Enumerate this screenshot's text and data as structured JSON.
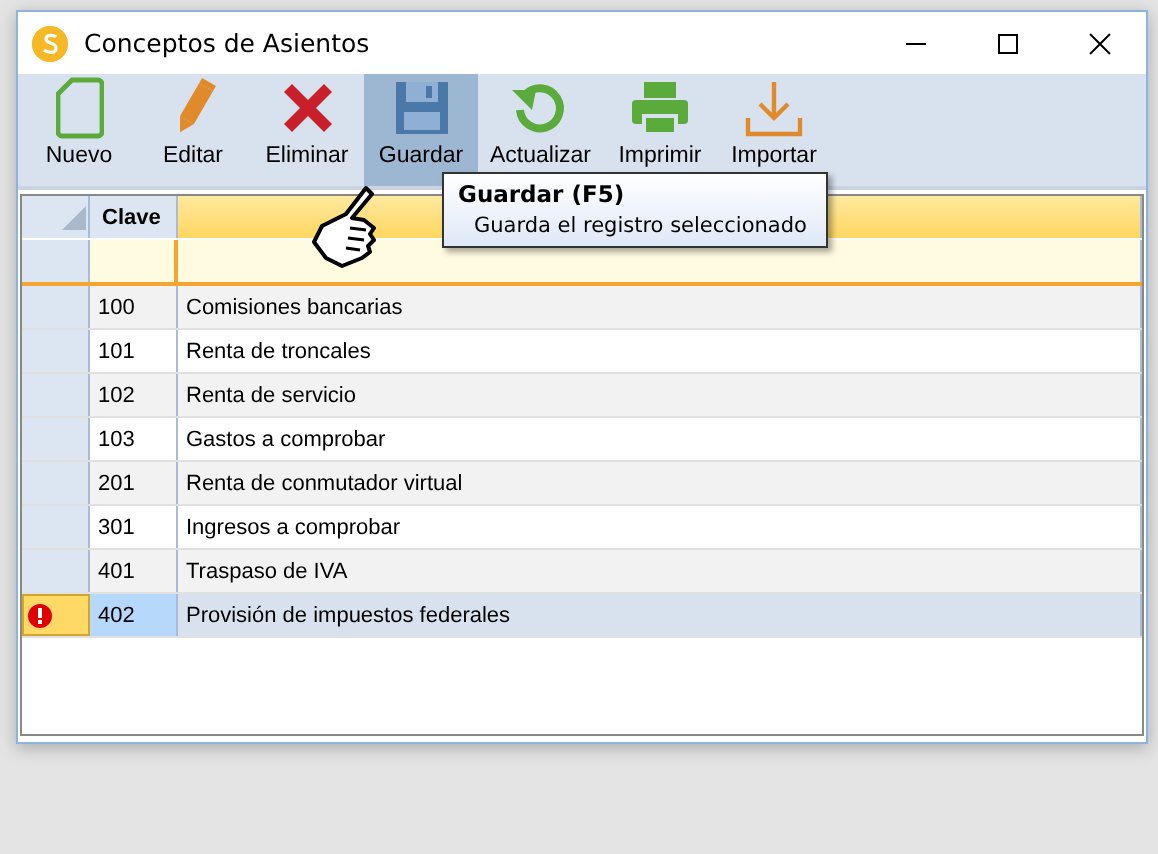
{
  "window": {
    "title": "Conceptos de Asientos"
  },
  "toolbar": [
    {
      "label": "Nuevo",
      "kind": "new",
      "selected": false
    },
    {
      "label": "Editar",
      "kind": "edit",
      "selected": false
    },
    {
      "label": "Eliminar",
      "kind": "delete",
      "selected": false
    },
    {
      "label": "Guardar",
      "kind": "save",
      "selected": true
    },
    {
      "label": "Actualizar",
      "kind": "refresh",
      "selected": false
    },
    {
      "label": "Imprimir",
      "kind": "print",
      "selected": false
    },
    {
      "label": "Importar",
      "kind": "import",
      "selected": false
    }
  ],
  "tooltip": {
    "title": "Guardar (F5)",
    "text": "Guarda el registro seleccionado"
  },
  "grid": {
    "columns": [
      "Clave"
    ],
    "rows": [
      {
        "clave": "100",
        "column_2": "Comisiones bancarias",
        "selected": false,
        "error": false
      },
      {
        "clave": "101",
        "column_2": "Renta de troncales",
        "selected": false,
        "error": false
      },
      {
        "clave": "102",
        "column_2": "Renta de servicio",
        "selected": false,
        "error": false
      },
      {
        "clave": "103",
        "column_2": "Gastos a comprobar",
        "selected": false,
        "error": false
      },
      {
        "clave": "201",
        "column_2": "Renta de conmutador virtual",
        "selected": false,
        "error": false
      },
      {
        "clave": "301",
        "column_2": "Ingresos a comprobar",
        "selected": false,
        "error": false
      },
      {
        "clave": "401",
        "column_2": "Traspaso de IVA",
        "selected": false,
        "error": false
      },
      {
        "clave": "402",
        "column_2": "Provisión de impuestos federales",
        "selected": true,
        "error": true
      }
    ]
  }
}
